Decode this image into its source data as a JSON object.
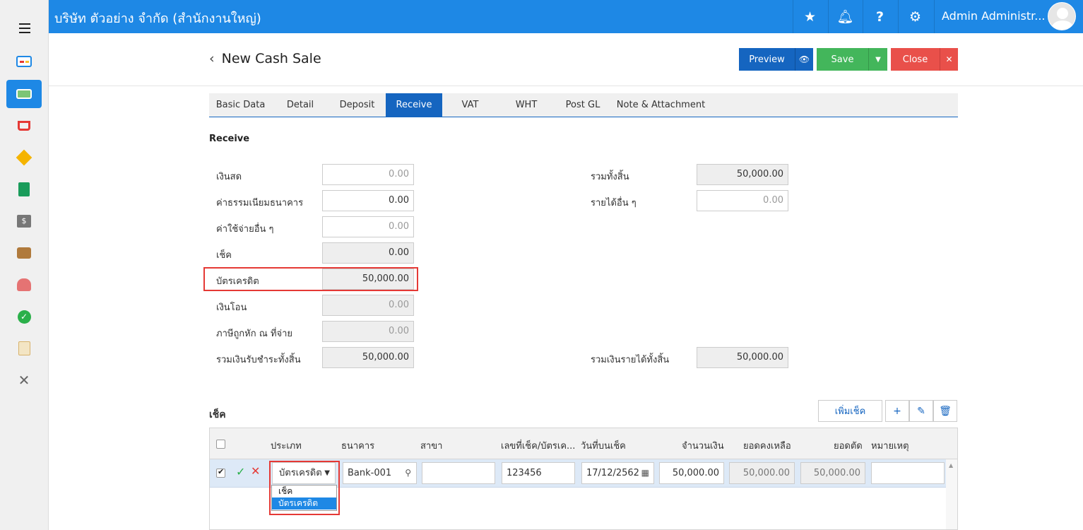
{
  "topbar": {
    "company": "บริษัท ตัวอย่าง จำกัด (สำนักงานใหญ่)",
    "user_name": "Admin Administr...",
    "icons": [
      "star-icon",
      "bell-icon",
      "help-icon",
      "gear-icon"
    ]
  },
  "page": {
    "title": "New Cash Sale",
    "preview_label": "Preview",
    "save_label": "Save",
    "close_label": "Close"
  },
  "tabs": [
    "Basic Data",
    "Detail",
    "Deposit",
    "Receive",
    "VAT",
    "WHT",
    "Post GL",
    "Note & Attachment"
  ],
  "active_tab": "Receive",
  "receive": {
    "section_title": "Receive",
    "left": [
      {
        "label": "เงินสด",
        "value": "0.00",
        "style": "placeholder"
      },
      {
        "label": "ค่าธรรมเนียมธนาคาร",
        "value": "0.00",
        "style": "editable"
      },
      {
        "label": "ค่าใช้จ่ายอื่น ๆ",
        "value": "0.00",
        "style": "placeholder"
      },
      {
        "label": "เช็ค",
        "value": "0.00",
        "style": "readonly"
      },
      {
        "label": "บัตรเครดิต",
        "value": "50,000.00",
        "style": "readonly"
      },
      {
        "label": "เงินโอน",
        "value": "0.00",
        "style": "readonly-ph"
      },
      {
        "label": "ภาษีถูกหัก ณ ที่จ่าย",
        "value": "0.00",
        "style": "readonly-ph"
      },
      {
        "label": "รวมเงินรับชำระทั้งสิ้น",
        "value": "50,000.00",
        "style": "readonly"
      }
    ],
    "right": [
      {
        "label": "รวมทั้งสิ้น",
        "value": "50,000.00",
        "style": "readonly"
      },
      {
        "label": "รายได้อื่น ๆ",
        "value": "0.00",
        "style": "placeholder"
      },
      {
        "label": "รวมเงินรายได้ทั้งสิ้น",
        "value": "50,000.00",
        "style": "readonly"
      }
    ]
  },
  "check_section": {
    "title": "เช็ค",
    "add_button": "เพิ่มเช็ค",
    "columns": [
      "ประเภท",
      "ธนาคาร",
      "สาขา",
      "เลขที่เช็ค/บัตรเค...",
      "วันที่บนเช็ค",
      "จำนวนเงิน",
      "ยอดคงเหลือ",
      "ยอดตัด",
      "หมายเหตุ"
    ],
    "row": {
      "type": "บัตรเครดิต",
      "bank": "Bank-001",
      "branch": "",
      "number": "123456",
      "date": "17/12/2562",
      "amount": "50,000.00",
      "balance": "50,000.00",
      "cut": "50,000.00",
      "note": ""
    },
    "type_options": [
      "เช็ค",
      "บัตรเครดิต"
    ]
  }
}
